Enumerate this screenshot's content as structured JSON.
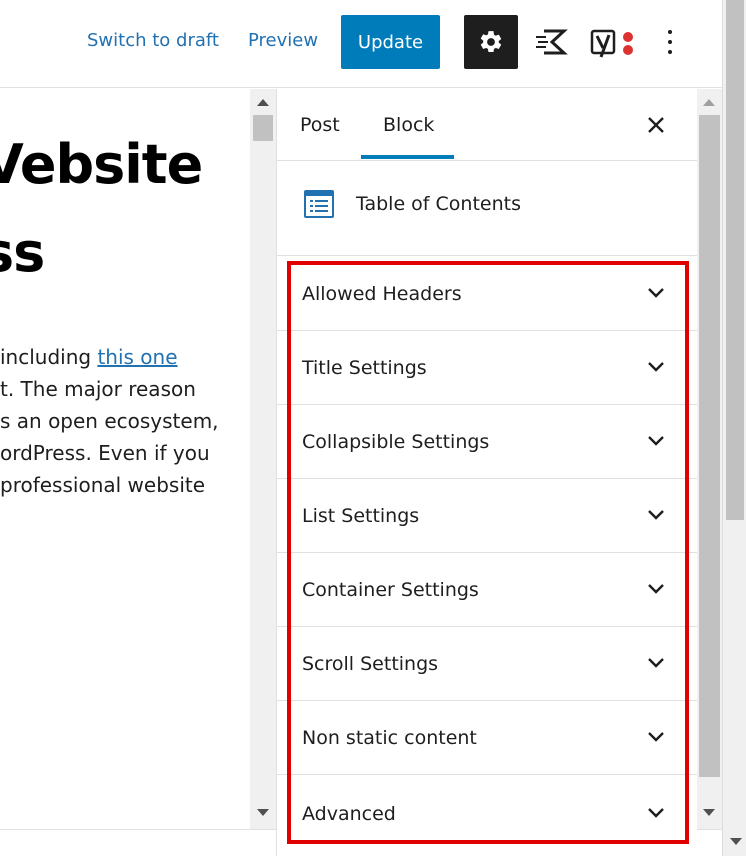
{
  "toolbar": {
    "switch_to_draft": "Switch to draft",
    "preview": "Preview",
    "update": "Update",
    "settings_icon": "gear-icon",
    "kadence_icon": "kadence-icon",
    "yoast_icon": "yoast-icon",
    "more_icon": "more-vertical-icon",
    "accent_color": "#007cba",
    "link_color": "#2271b1"
  },
  "content": {
    "title_lines": [
      "Vebsite",
      "ss"
    ],
    "paragraph": {
      "line1_prefix": " including ",
      "line1_link": "this one",
      "line2": "t. The major reason",
      "line3": "s an open ecosystem,",
      "line4": "ordPress. Even if you",
      "line5": "professional website"
    }
  },
  "sidebar": {
    "tabs": [
      {
        "label": "Post",
        "active": false
      },
      {
        "label": "Block",
        "active": true
      }
    ],
    "close_icon": "close-icon",
    "block": {
      "icon": "table-of-contents-icon",
      "name": "Table of Contents"
    },
    "panels": [
      {
        "label": "Allowed Headers"
      },
      {
        "label": "Title Settings"
      },
      {
        "label": "Collapsible Settings"
      },
      {
        "label": "List Settings"
      },
      {
        "label": "Container Settings"
      },
      {
        "label": "Scroll Settings"
      },
      {
        "label": "Non static content"
      },
      {
        "label": "Advanced"
      }
    ],
    "highlight_color": "#e00000"
  }
}
